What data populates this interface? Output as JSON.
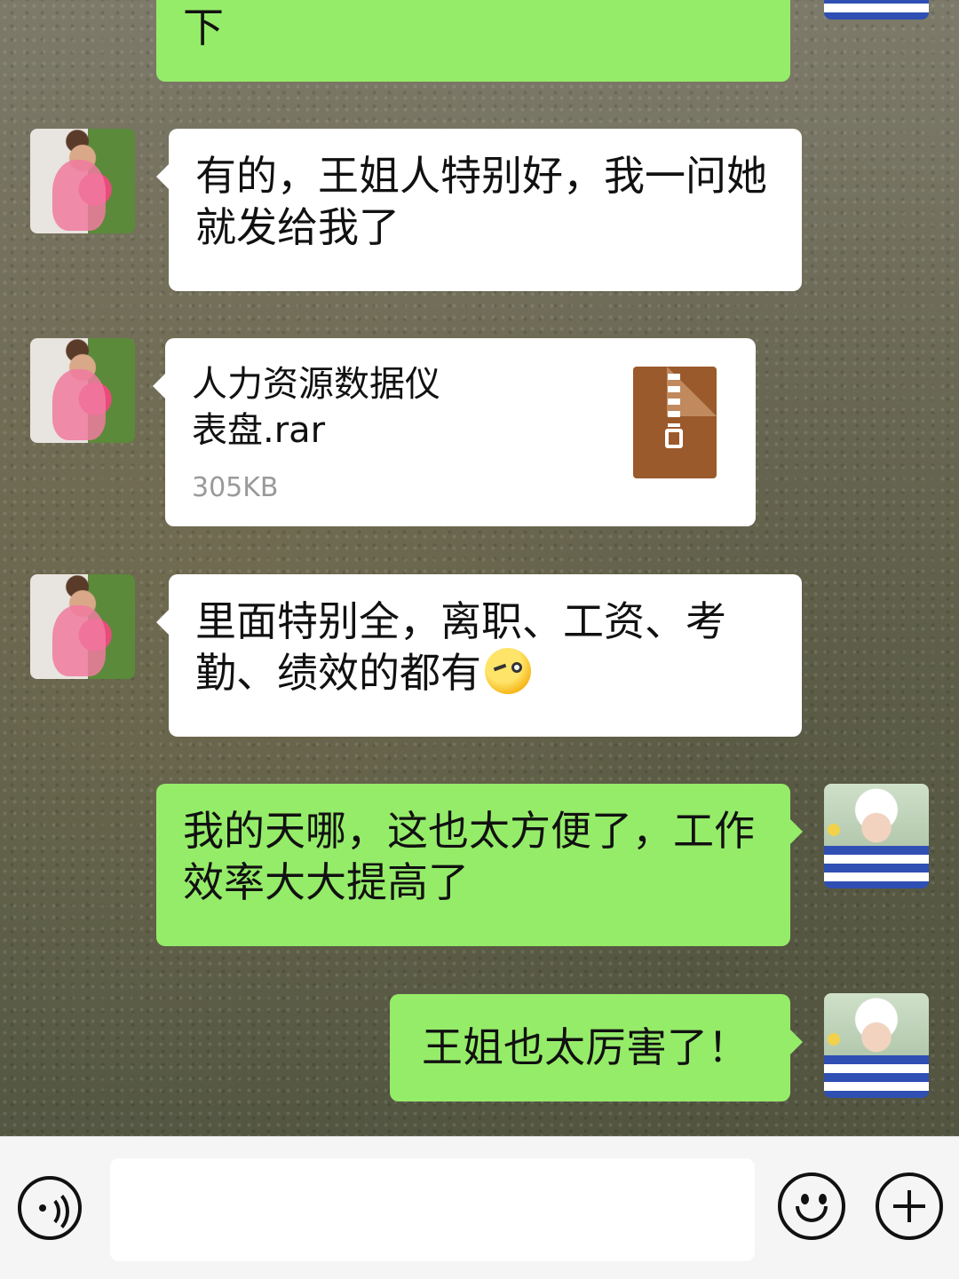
{
  "messages": [
    {
      "side": "right",
      "type": "text",
      "text": "下"
    },
    {
      "side": "left",
      "type": "text",
      "text": "有的，王姐人特别好，我一问她就发给我了"
    },
    {
      "side": "left",
      "type": "file",
      "file_name": "人力资源数据仪表盘.rar",
      "file_size": "305KB",
      "icon": "zip-file-icon"
    },
    {
      "side": "left",
      "type": "text",
      "text": "里面特别全，离职、工资、考勤、绩效的都有",
      "emoji": "wink-face-emoji"
    },
    {
      "side": "right",
      "type": "text",
      "text": "我的天哪，这也太方便了，工作效率大大提高了"
    },
    {
      "side": "right",
      "type": "text",
      "text": "王姐也太厉害了！"
    }
  ],
  "input_bar": {
    "voice_icon": "voice-icon",
    "text_value": "",
    "emoji_icon": "emoji-icon",
    "plus_icon": "plus-icon"
  },
  "colors": {
    "sent_bubble": "#95ec69",
    "received_bubble": "#ffffff",
    "input_bar_bg": "#f5f5f5"
  }
}
